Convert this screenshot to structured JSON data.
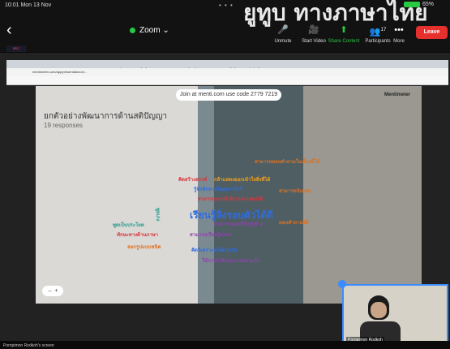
{
  "status": {
    "time": "10:01  Mon 13 Nov",
    "battery": "65%"
  },
  "watermark": "ยูทูบ ทางภาษาไทย",
  "zoom": {
    "title": "Zoom",
    "chevron": "⌄",
    "toolbar": [
      {
        "label": "Unmute",
        "icon": "microphone-off-icon",
        "glyph": "🎤"
      },
      {
        "label": "Start Video",
        "icon": "video-off-icon",
        "glyph": "🎥"
      },
      {
        "label": "Share Content",
        "icon": "share-icon",
        "glyph": "⬆"
      },
      {
        "label": "Participants",
        "icon": "participants-icon",
        "glyph": "👥",
        "count": "17"
      },
      {
        "label": "More",
        "icon": "more-icon",
        "glyph": "•••"
      }
    ],
    "leave": "Leave",
    "share_content_color": "#28c940",
    "leave_color": "#e5302d"
  },
  "browser": {
    "tabs": [
      "(3) Facebook",
      "ยกตัวอย่างพัฒนา",
      "Mentimeter",
      "Mentimeter",
      "กิจกรรม",
      "เช็คชื่อ - Canva",
      "Canva",
      "ห้องเรียน Google",
      "pexels ใจดีรอ",
      "ข้อคิดเห็นฯ"
    ],
    "url": "mentimeter.com/app/presentation/al…"
  },
  "slide": {
    "join_text": "Join at menti.com use code 2779 7219",
    "logo": "Mentimeter",
    "title": "ยกตัวอย่างพัฒนาการด้านสติปัญญา",
    "responses": "19 responses",
    "words": [
      {
        "text": "เรียนรู้สิ่งรอบตัวได้ดี",
        "color": "#2f6de0"
      },
      {
        "text": "กล้าแสดงออกเข้าใจสิ่งที่ได้",
        "color": "#f0a020"
      },
      {
        "text": "รู้จักทักทายโดยการไหว้",
        "color": "#2f6de0"
      },
      {
        "text": "สามารถบอกสีเขียวกลางช่องได้",
        "color": "#d9363e"
      },
      {
        "text": "สามารถนับเลข",
        "color": "#e07020"
      },
      {
        "text": "ตอบคำถามได้",
        "color": "#e07020"
      },
      {
        "text": "พูดเป็นประโยค",
        "color": "#2a9d8f"
      },
      {
        "text": "ทักษะทางด้านภาษา",
        "color": "#d9363e"
      },
      {
        "text": "ลอกรูปแบบชนิด",
        "color": "#e07020"
      },
      {
        "text": "สามารถเรียนรู้ภาษา",
        "color": "#8e44ad"
      },
      {
        "text": "คิดวิเคราะห์ได้ตามวัย",
        "color": "#2f6de0"
      },
      {
        "text": "ใช้ภาษาได้เหมาะสมตามวัย",
        "color": "#8e44ad"
      },
      {
        "text": "คิดสร้างสรรค์",
        "color": "#d9363e"
      },
      {
        "text": "พูดเก่ง",
        "color": "#2a9d8f"
      },
      {
        "text": "สามารถบอกสีกับรูปร่าง",
        "color": "#8e44ad"
      },
      {
        "text": "สามารถตอบคำถามในเรื่องที่ได้",
        "color": "#e07020"
      }
    ],
    "nav": "←  +"
  },
  "thumbnail": {
    "name": "Pornpimon Rodkoh"
  },
  "screen_owner": "Pornpimon Rodkoh's screen",
  "rec": "REC"
}
